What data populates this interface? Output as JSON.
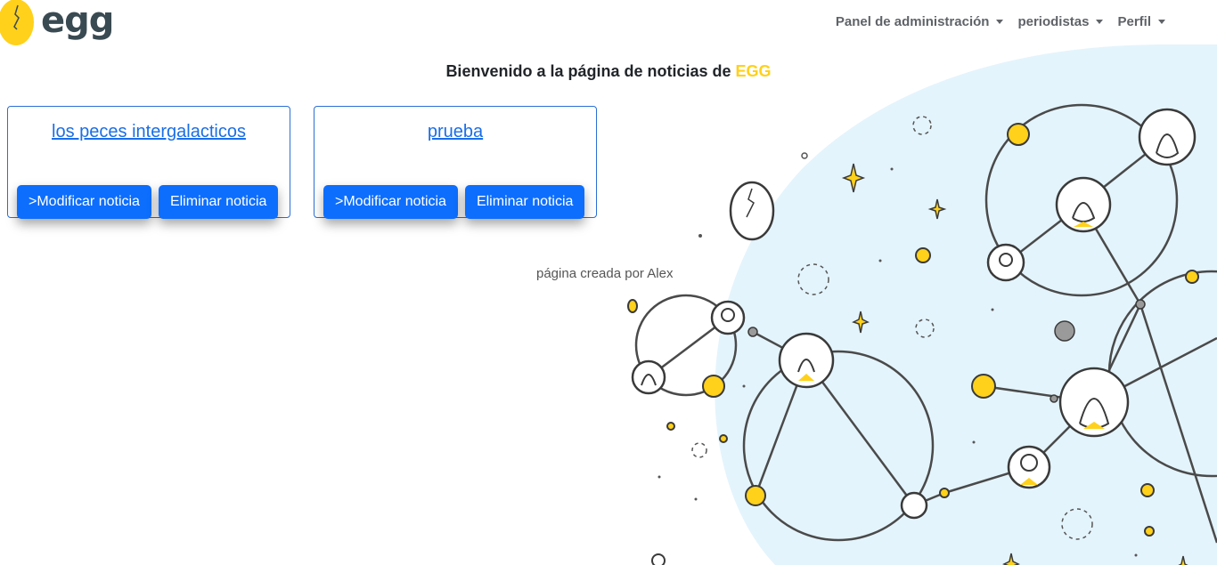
{
  "navbar": {
    "brand": "egg",
    "menu": [
      {
        "label": "Panel de administración"
      },
      {
        "label": "periodistas"
      },
      {
        "label": "Perfil"
      }
    ]
  },
  "welcome": {
    "text": "Bienvenido a la página de noticias de ",
    "brand_word": "EGG"
  },
  "news": [
    {
      "title": "los peces intergalacticos",
      "modify_label": ">Modificar noticia",
      "delete_label": "Eliminar noticia"
    },
    {
      "title": "prueba",
      "modify_label": ">Modificar noticia",
      "delete_label": "Eliminar noticia"
    }
  ],
  "footer": {
    "credit": "página creada por Alex"
  },
  "colors": {
    "accent_yellow": "#ffd11a",
    "primary_blue": "#0d6efd",
    "link_blue": "#1a6ee6",
    "illustration_bg": "#e4f4fc"
  }
}
